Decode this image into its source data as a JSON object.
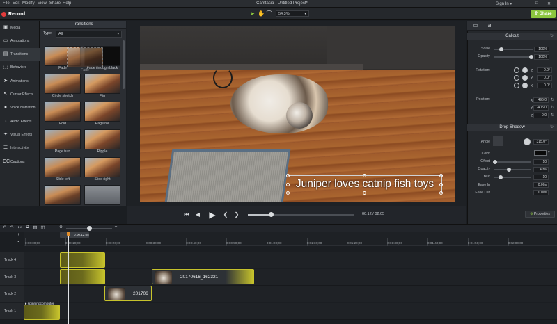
{
  "menu": [
    "File",
    "Edit",
    "Modify",
    "View",
    "Share",
    "Help"
  ],
  "app_title": "Camtasia - Untitled Project*",
  "sign_in": "Sign In ▾",
  "toolbar": {
    "record_label": "Record",
    "zoom_value": "54.3%",
    "share_label": "Share"
  },
  "rail": {
    "items": [
      {
        "label": "Media",
        "icon": "film-icon"
      },
      {
        "label": "Annotations",
        "icon": "annotation-icon"
      },
      {
        "label": "Transitions",
        "icon": "transition-icon"
      },
      {
        "label": "Behaviors",
        "icon": "behavior-icon"
      },
      {
        "label": "Animations",
        "icon": "arrow-icon"
      },
      {
        "label": "Cursor Effects",
        "icon": "cursor-icon"
      },
      {
        "label": "Voice Narration",
        "icon": "microphone-icon"
      },
      {
        "label": "Audio Effects",
        "icon": "speaker-icon"
      },
      {
        "label": "Visual Effects",
        "icon": "visual-effects-icon"
      },
      {
        "label": "Interactivity",
        "icon": "interactivity-icon"
      },
      {
        "label": "Captions",
        "icon": "captions-icon"
      }
    ]
  },
  "transitions": {
    "title": "Transitions",
    "type_label": "Type:",
    "type_value": "All",
    "items": [
      {
        "label": "Fade",
        "style": "mtn"
      },
      {
        "label": "Fade through black",
        "style": "black"
      },
      {
        "label": "Circle stretch",
        "style": "mtn"
      },
      {
        "label": "Flip",
        "style": "mtn2"
      },
      {
        "label": "Fold",
        "style": "mtn"
      },
      {
        "label": "Page roll",
        "style": "mtn2"
      },
      {
        "label": "Page turn",
        "style": "mtn"
      },
      {
        "label": "Ripple",
        "style": "mtn2"
      },
      {
        "label": "Slide left",
        "style": "mtn"
      },
      {
        "label": "Slide right",
        "style": "mtn2"
      },
      {
        "label": "",
        "style": "mtn"
      },
      {
        "label": "",
        "style": "grey"
      }
    ],
    "drag_ghost": "Fade"
  },
  "canvas": {
    "caption": "Juniper loves catnip fish toys"
  },
  "playback": {
    "time": "00:12 / 02:05",
    "progress": 0.22
  },
  "properties": {
    "callout_title": "Callout",
    "scale_label": "Scale",
    "scale_value": "100%",
    "opacity_label": "Opacity",
    "opacity_value": "100%",
    "rotation_label": "Rotation:",
    "rot_z": "0.0°",
    "rot_y": "0.0°",
    "rot_x": "0.0°",
    "position_label": "Position:",
    "pos_x": "496.0",
    "pos_y": "-405.0",
    "pos_z": "0.0",
    "drop_shadow_title": "Drop Shadow",
    "angle_label": "Angle",
    "angle_value": "315.0°",
    "color_label": "Color",
    "offset_label": "Offset",
    "offset_value": "10",
    "ds_opacity_label": "Opacity",
    "ds_opacity_value": "40%",
    "blur_label": "Blur",
    "blur_value": "10",
    "ease_in_label": "Ease In",
    "ease_in_value": "0.00s",
    "ease_out_label": "Ease Out",
    "ease_out_value": "0.00s",
    "properties_button": "Properties"
  },
  "timeline": {
    "playhead": "0:00:12;05",
    "ticks": [
      "0:00:00;00",
      "0:00:10;00",
      "0:00:20;00",
      "0:00:30;00",
      "0:00:40;00",
      "0:00:50;00",
      "0:01:00;00",
      "0:01:10;00",
      "0:01:20;00",
      "0:01:30;00",
      "0:01:40;00",
      "0:01:50;00",
      "0:02:00;00"
    ],
    "tracks": [
      "Track 4",
      "Track 3",
      "Track 2",
      "Track 1"
    ],
    "clip_main": "20170616_162321",
    "clip_t2": "201706",
    "clip_t1_label": "▸ spinningcomputer"
  }
}
